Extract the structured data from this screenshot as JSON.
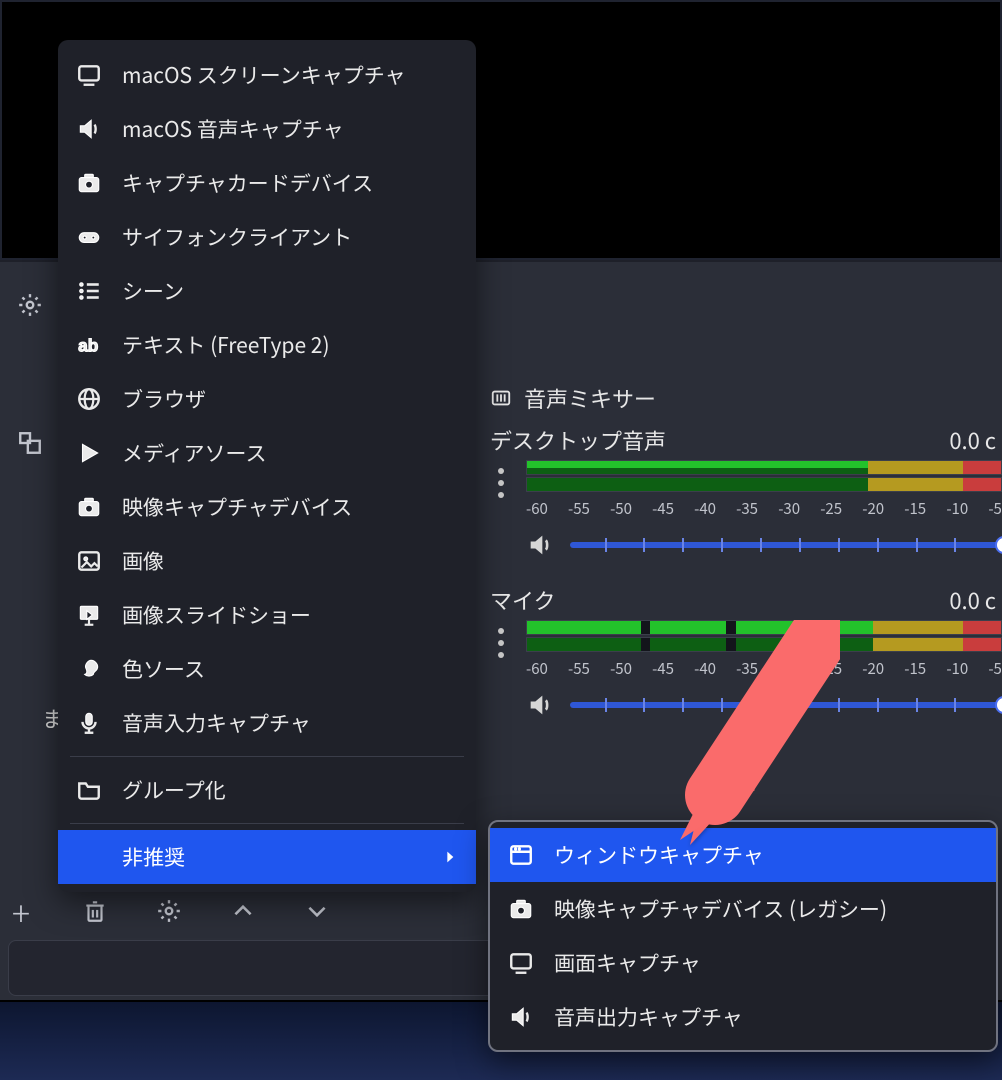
{
  "preview": {
    "title": ""
  },
  "leftRail": {
    "gear": "settings",
    "scenes": "scenes"
  },
  "strayChar": "ま",
  "toolbar": {
    "plus": "+",
    "trash": "trash",
    "gear": "settings",
    "up": "up",
    "down": "down"
  },
  "mixer": {
    "title": "音声ミキサー",
    "channels": [
      {
        "name": "デスクトップ音声",
        "level": "0.0 c"
      },
      {
        "name": "マイク",
        "level": "0.0 c"
      }
    ],
    "scale": [
      "-60",
      "-55",
      "-50",
      "-45",
      "-40",
      "-35",
      "-30",
      "-25",
      "-20",
      "-15",
      "-10",
      "-5"
    ]
  },
  "menu": {
    "items": [
      {
        "icon": "monitor-icon",
        "label": "macOS スクリーンキャプチャ"
      },
      {
        "icon": "speaker-icon",
        "label": "macOS 音声キャプチャ"
      },
      {
        "icon": "camera-icon",
        "label": "キャプチャカードデバイス"
      },
      {
        "icon": "gamepad-icon",
        "label": "サイフォンクライアント"
      },
      {
        "icon": "list-icon",
        "label": "シーン"
      },
      {
        "icon": "ab-icon",
        "label": "テキスト (FreeType 2)"
      },
      {
        "icon": "globe-icon",
        "label": "ブラウザ"
      },
      {
        "icon": "play-icon",
        "label": "メディアソース"
      },
      {
        "icon": "camera-icon",
        "label": "映像キャプチャデバイス"
      },
      {
        "icon": "image-icon",
        "label": "画像"
      },
      {
        "icon": "slideshow-icon",
        "label": "画像スライドショー"
      },
      {
        "icon": "brush-icon",
        "label": "色ソース"
      },
      {
        "icon": "microphone-icon",
        "label": "音声入力キャプチャ"
      }
    ],
    "group": {
      "icon": "folder-icon",
      "label": "グループ化"
    },
    "deprecated": {
      "label": "非推奨"
    }
  },
  "submenu": {
    "items": [
      {
        "icon": "window-icon",
        "label": "ウィンドウキャプチャ",
        "highlight": true
      },
      {
        "icon": "camera-icon",
        "label": "映像キャプチャデバイス (レガシー)"
      },
      {
        "icon": "monitor-icon",
        "label": "画面キャプチャ"
      },
      {
        "icon": "speaker-icon",
        "label": "音声出力キャプチャ"
      }
    ]
  }
}
